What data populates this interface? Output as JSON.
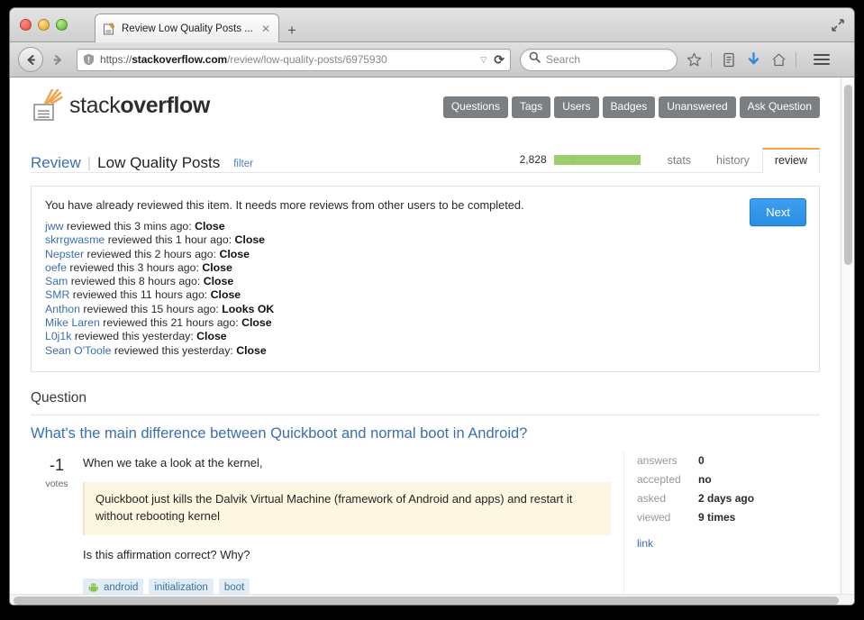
{
  "browser": {
    "tab": {
      "title": "Review Low Quality Posts ...",
      "favicon": "stackoverflow-favicon",
      "close": "✕"
    },
    "new_tab": "+",
    "url": {
      "protocol": "https://",
      "host": "stackoverflow.com",
      "path": "/review/low-quality-posts/6975930"
    },
    "search_placeholder": "Search",
    "icons": {
      "back": "back-arrow-icon",
      "forward": "forward-arrow-icon",
      "identity": "warning-shield-icon",
      "dropdown": "▽",
      "reload": "⟳",
      "bookmark": "star-icon",
      "reader": "reader-list-icon",
      "downloads": "download-arrow-icon",
      "home": "home-icon",
      "menu": "hamburger-menu-icon",
      "maximize": "maximize-icon"
    }
  },
  "site": {
    "logo": {
      "light": "stack",
      "bold": "overflow"
    },
    "nav": [
      "Questions",
      "Tags",
      "Users",
      "Badges",
      "Unanswered",
      "Ask Question"
    ]
  },
  "review": {
    "breadcrumb_link": "Review",
    "breadcrumb_sep": "|",
    "queue_name": "Low Quality Posts",
    "filter": "filter",
    "count": "2,828",
    "progress_percent": 100,
    "progress_color": "#9dce6e",
    "tabs": [
      {
        "label": "stats",
        "active": false
      },
      {
        "label": "history",
        "active": false
      },
      {
        "label": "review",
        "active": true
      }
    ],
    "notice": "You have already reviewed this item. It needs more reviews from other users to be completed.",
    "next_button": "Next",
    "entries": [
      {
        "user": "jww",
        "middle": " reviewed this 3 mins ago: ",
        "action": "Close"
      },
      {
        "user": "skrrgwasme",
        "middle": " reviewed this 1 hour ago: ",
        "action": "Close"
      },
      {
        "user": "Nepster",
        "middle": " reviewed this 2 hours ago: ",
        "action": "Close"
      },
      {
        "user": "oefe",
        "middle": " reviewed this 3 hours ago: ",
        "action": "Close"
      },
      {
        "user": "Sam",
        "middle": " reviewed this 8 hours ago: ",
        "action": "Close"
      },
      {
        "user": "SMR",
        "middle": " reviewed this 11 hours ago: ",
        "action": "Close"
      },
      {
        "user": "Anthon",
        "middle": " reviewed this 15 hours ago: ",
        "action": "Looks OK"
      },
      {
        "user": "Mike Laren",
        "middle": " reviewed this 21 hours ago: ",
        "action": "Close"
      },
      {
        "user": "L0j1k",
        "middle": " reviewed this yesterday: ",
        "action": "Close"
      },
      {
        "user": "Sean O'Toole",
        "middle": " reviewed this yesterday: ",
        "action": "Close"
      }
    ]
  },
  "question": {
    "section_heading": "Question",
    "title": "What's the main difference between Quickboot and normal boot in Android?",
    "votes": "-1",
    "votes_label": "votes",
    "paragraph_1": "When we take a look at the kernel,",
    "quote": "Quickboot just kills the Dalvik Virtual Machine (framework of Android and apps) and restart it without rebooting kernel",
    "paragraph_2": "Is this affirmation correct? Why?",
    "tags": [
      {
        "label": "android",
        "icon": "android-robot-icon"
      },
      {
        "label": "initialization",
        "icon": ""
      },
      {
        "label": "boot",
        "icon": ""
      }
    ],
    "stats": [
      {
        "key": "answers",
        "value": "0"
      },
      {
        "key": "accepted",
        "value": "no"
      },
      {
        "key": "asked",
        "value": "2 days ago"
      },
      {
        "key": "viewed",
        "value": "9 times"
      }
    ],
    "link_label": "link"
  }
}
